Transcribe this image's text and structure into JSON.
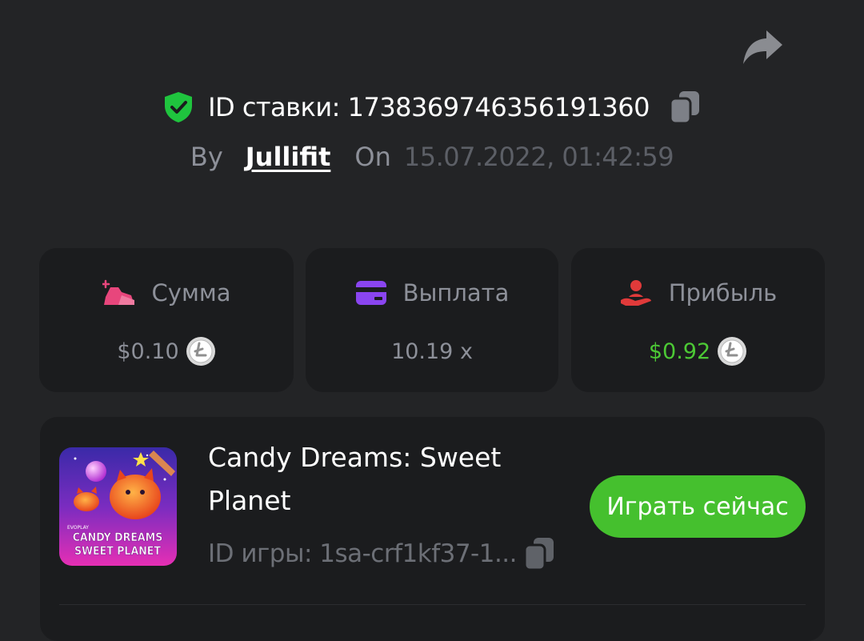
{
  "header": {
    "bet_id_text": "ID ставки: 1738369746356191360",
    "by_label": "By",
    "username": "Jullifit",
    "on_label": "On",
    "date": "15.07.2022, 01:42:59"
  },
  "stats": [
    {
      "label": "Сумма",
      "value": "$0.10",
      "icon": "money-bag-icon",
      "icon_color": "#e8467c",
      "has_coin": true,
      "value_color": "#8d9099"
    },
    {
      "label": "Выплата",
      "value": "10.19 x",
      "icon": "credit-card-icon",
      "icon_color": "#8a45f0",
      "has_coin": false,
      "value_color": "#8d9099"
    },
    {
      "label": "Прибыль",
      "value": "$0.92",
      "icon": "hand-profit-icon",
      "icon_color": "#e03a3a",
      "has_coin": true,
      "value_color": "#4cc935"
    }
  ],
  "game": {
    "title": "Candy Dreams: Sweet Planet",
    "id_text": "ID игры: 1sa-crf1kf37-1...",
    "play_label": "Играть сейчас",
    "thumb_brand": "EVOPLAY",
    "thumb_line1": "CANDY DREAMS",
    "thumb_line2": "SWEET PLANET"
  },
  "colors": {
    "background": "#232426",
    "card": "#1b1c1e",
    "accent_green": "#45c02e",
    "verified": "#1fc43e"
  }
}
